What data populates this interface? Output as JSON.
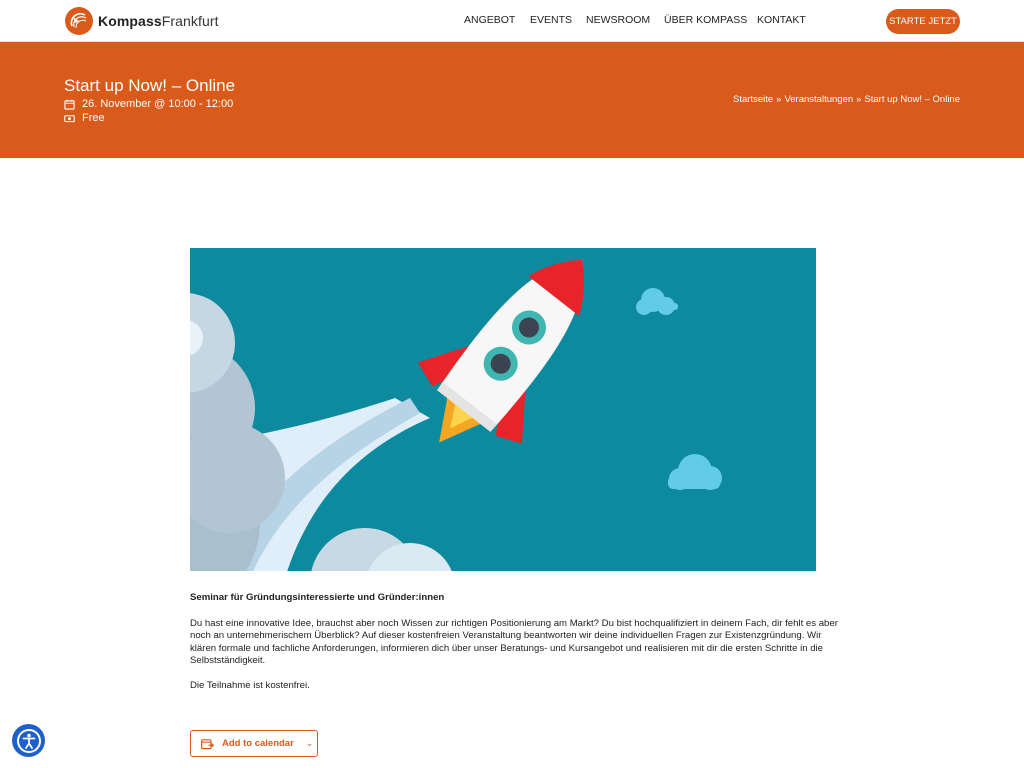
{
  "header": {
    "logo_bold": "Kompass",
    "logo_regular": "Frankfurt",
    "nav": [
      "ANGEBOT",
      "EVENTS",
      "NEWSROOM",
      "ÜBER KOMPASS",
      "KONTAKT"
    ],
    "cta_label": "STARTE JETZT"
  },
  "event": {
    "title": "Start up Now! – Online",
    "date": "26. November @ 10:00 - 12:00",
    "cost": "Free"
  },
  "breadcrumb": {
    "items": [
      "Startseite",
      "Veranstaltungen",
      "Start up Now! – Online"
    ],
    "separator": "»"
  },
  "content": {
    "heading": "Seminar für Gründungsinteressierte und Gründer:innen",
    "body": "Du hast eine innovative Idee, brauchst aber noch Wissen zur richtigen Positionierung am Markt? Du bist hochqualifiziert in deinem Fach, dir fehlt es aber noch an unternehmerischem Überblick? Auf dieser kostenfreien Veranstaltung beantworten wir deine individuellen Fragen zur Existenzgründung. Wir klären formale und fachliche Anforderungen, informieren dich über unser Beratungs- und Kursangebot und realisieren mit dir die ersten Schritte in die Selbstständigkeit.",
    "free_note": "Die Teilnahme ist kostenfrei."
  },
  "calendar_button": {
    "label": "Add to calendar"
  },
  "icons": {
    "logo": "compass-logo-icon",
    "date": "calendar-icon",
    "cost": "money-icon",
    "calendar_button": "calendar-export-icon",
    "dropdown": "chevron-down-icon",
    "accessibility": "accessibility-icon"
  },
  "colors": {
    "brand_orange": "#d95a1b",
    "hero_background": "#0e8a9e",
    "accessibility_blue": "#1f5fc9"
  }
}
